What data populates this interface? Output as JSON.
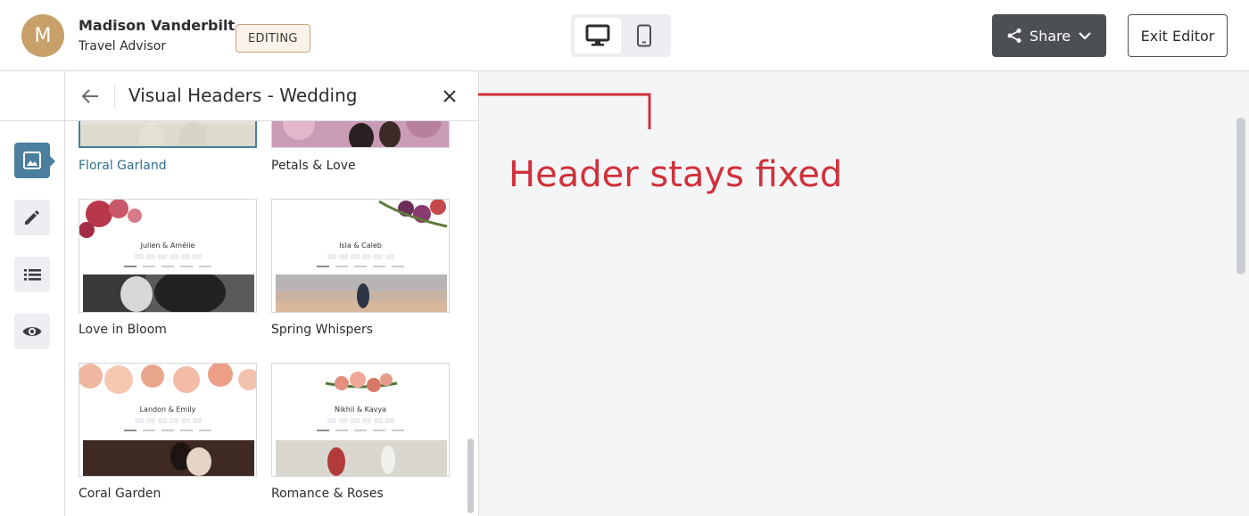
{
  "user": {
    "initial": "M",
    "name": "Madison Vanderbilt",
    "role": "Travel Advisor"
  },
  "status_badge": "EDITING",
  "device_toggle": {
    "selected": "desktop"
  },
  "header_actions": {
    "share_label": "Share",
    "exit_label": "Exit Editor"
  },
  "sidebar_rail": {
    "items": [
      "image-icon",
      "pencil-icon",
      "list-icon",
      "eye-icon"
    ],
    "active": "image-icon"
  },
  "panel": {
    "title": "Visual Headers - Wedding",
    "cards": [
      {
        "label": "Floral Garland",
        "selected": true
      },
      {
        "label": "Petals & Love"
      },
      {
        "label": "Love in Bloom",
        "couple": "Julien & Amélie"
      },
      {
        "label": "Spring Whispers",
        "couple": "Isla & Caleb"
      },
      {
        "label": "Coral Garden",
        "couple": "Landon & Emily"
      },
      {
        "label": "Romance & Roses",
        "couple": "Nikhil & Kavya"
      }
    ]
  },
  "annotation": {
    "text": "Header stays fixed",
    "color": "#d0313a"
  },
  "colors": {
    "accent": "#4a7fa0",
    "share_bg": "#4c4f54",
    "canvas_bg": "#f4f5f7",
    "badge_border": "#c9a47a"
  }
}
